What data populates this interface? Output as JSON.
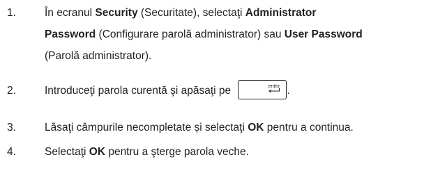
{
  "steps": [
    {
      "number": "1.",
      "line1_pre": "În ecranul ",
      "line1_b1": "Security",
      "line1_mid": " (Securitate), selectaţi ",
      "line1_b2": "Administrator",
      "line2_b1": "Password",
      "line2_mid": " (Configurare parolă administrator) sau ",
      "line2_b2": "User Password",
      "line3": "(Parolă administrator)."
    },
    {
      "number": "2.",
      "pre": "Introduceţi parola curentă şi apăsaţi pe ",
      "key_label": "enter",
      "key_icon": "enter-arrow-icon",
      "post": "."
    },
    {
      "number": "3.",
      "pre": "Lăsaţi câmpurile necompletate și selectaţi ",
      "bold": "OK",
      "post": " pentru a continua."
    },
    {
      "number": "4.",
      "pre": "Selectaţi ",
      "bold": "OK",
      "post": " pentru a şterge parola veche."
    }
  ],
  "colors": {
    "text": "#231f20",
    "background": "#ffffff"
  }
}
